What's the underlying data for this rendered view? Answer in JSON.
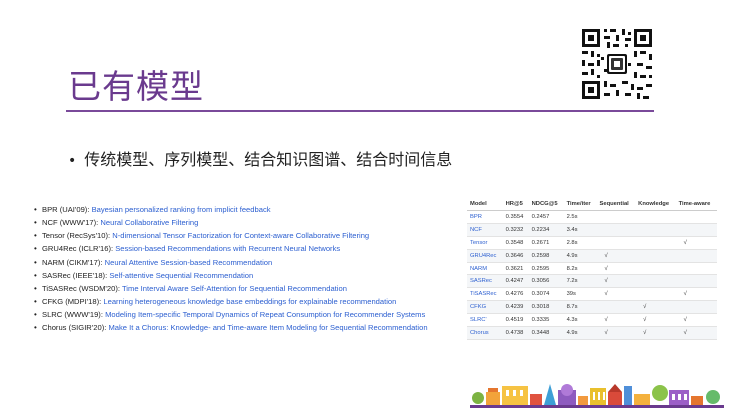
{
  "slide": {
    "title": "已有模型",
    "bullet": "传统模型、序列模型、结合知识图谱、结合时间信息",
    "bullet_symbol": "•"
  },
  "references": [
    {
      "name": "BPR (UAI'09):",
      "link": "Bayesian personalized ranking from implicit feedback"
    },
    {
      "name": "NCF (WWW'17):",
      "link": "Neural Collaborative Filtering"
    },
    {
      "name": "Tensor (RecSys'10):",
      "link": "N-dimensional Tensor Factorization for Context-aware Collaborative Filtering"
    },
    {
      "name": "GRU4Rec (ICLR'16):",
      "link": "Session-based Recommendations with Recurrent Neural Networks"
    },
    {
      "name": "NARM (CIKM'17):",
      "link": "Neural Attentive Session-based Recommendation"
    },
    {
      "name": "SASRec (IEEE'18):",
      "link": "Self-attentive Sequential Recommendation"
    },
    {
      "name": "TiSASRec (WSDM'20):",
      "link": "Time Interval Aware Self-Attention for Sequential Recommendation"
    },
    {
      "name": "CFKG (MDPI'18):",
      "link": "Learning heterogeneous knowledge base embeddings for explainable recommendation"
    },
    {
      "name": "SLRC (WWW'19):",
      "link": "Modeling Item-specific Temporal Dynamics of Repeat Consumption for Recommender Systems"
    },
    {
      "name": "Chorus (SIGIR'20):",
      "link": "Make It a Chorus: Knowledge- and Time-aware Item Modeling for Sequential Recommendation"
    }
  ],
  "table": {
    "headers": [
      "Model",
      "HR@5",
      "NDCG@5",
      "Time/iter",
      "Sequential",
      "Knowledge",
      "Time-aware"
    ],
    "rows": [
      [
        "BPR",
        "0.3554",
        "0.2457",
        "2.5s",
        "",
        "",
        ""
      ],
      [
        "NCF",
        "0.3232",
        "0.2234",
        "3.4s",
        "",
        "",
        ""
      ],
      [
        "Tensor",
        "0.3548",
        "0.2671",
        "2.8s",
        "",
        "",
        "√"
      ],
      [
        "GRU4Rec",
        "0.3646",
        "0.2598",
        "4.9s",
        "√",
        "",
        ""
      ],
      [
        "NARM",
        "0.3621",
        "0.2595",
        "8.2s",
        "√",
        "",
        ""
      ],
      [
        "SASRec",
        "0.4247",
        "0.3056",
        "7.2s",
        "√",
        "",
        ""
      ],
      [
        "TiSASRec",
        "0.4276",
        "0.3074",
        "39s",
        "√",
        "",
        "√"
      ],
      [
        "CFKG",
        "0.4239",
        "0.3018",
        "8.7s",
        "",
        "√",
        ""
      ],
      [
        "SLRC'",
        "0.4519",
        "0.3335",
        "4.3s",
        "√",
        "√",
        "√"
      ],
      [
        "Chorus",
        "0.4738",
        "0.3448",
        "4.9s",
        "√",
        "√",
        "√"
      ]
    ]
  },
  "colors": {
    "title": "#6a3a8e",
    "rule": "#7a4a9a",
    "link": "#2c5fd0"
  },
  "icons": [
    "qr-code-icon",
    "campus-skyline-icon"
  ]
}
